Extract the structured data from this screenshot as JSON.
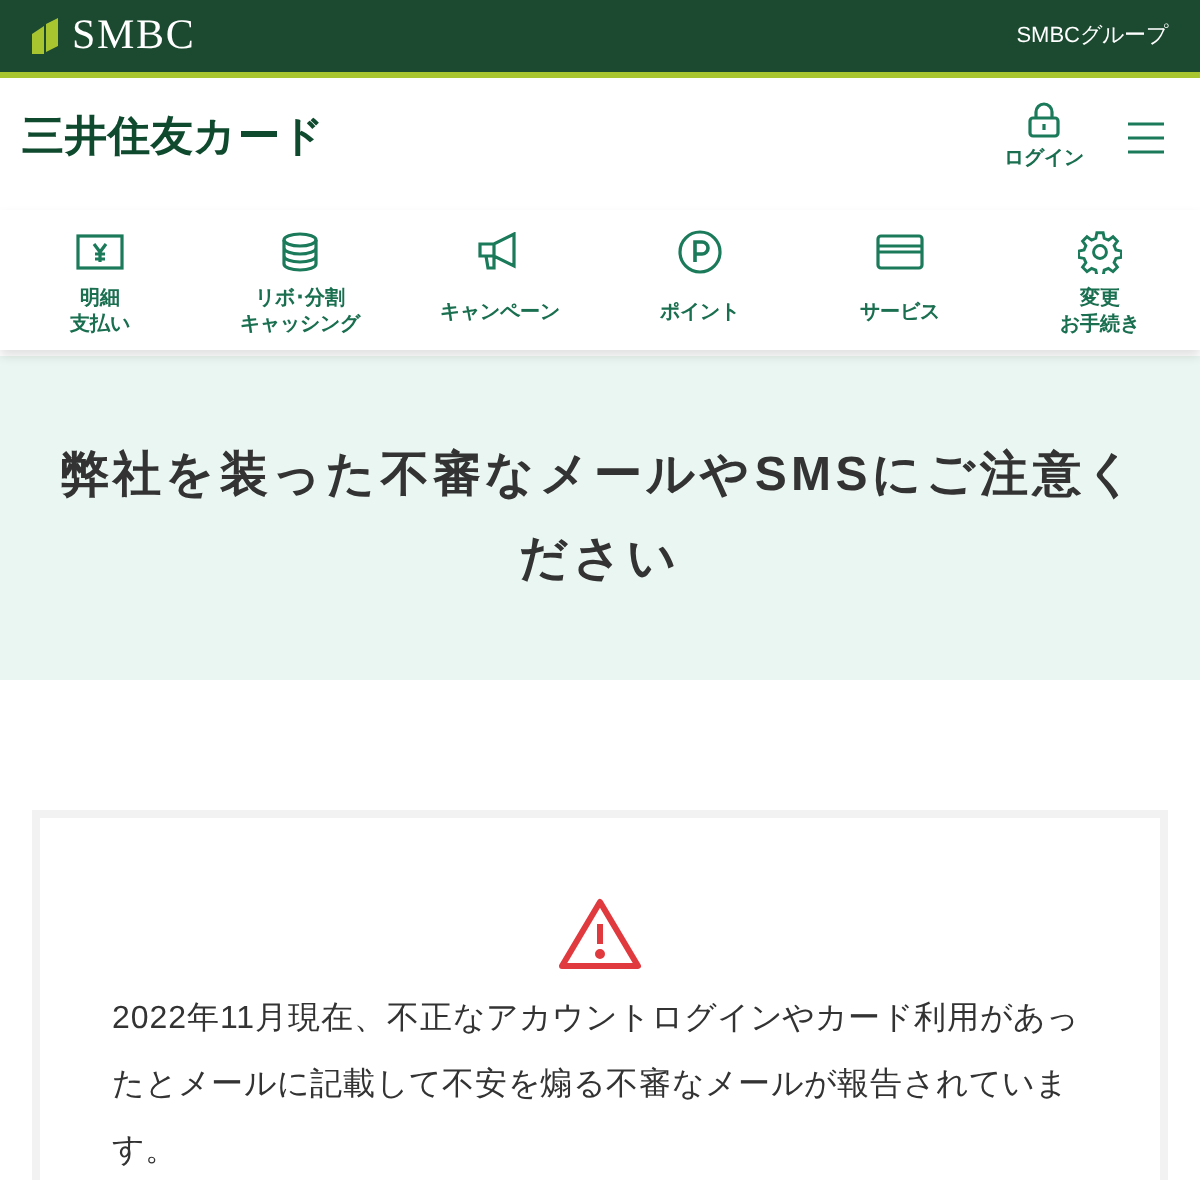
{
  "top_bar": {
    "brand": "SMBC",
    "group_link": "SMBCグループ"
  },
  "header": {
    "logo": "三井住友カード",
    "login": "ログイン"
  },
  "nav": [
    {
      "kind": "yen",
      "label_lines": [
        "明細",
        "支払い"
      ]
    },
    {
      "kind": "coins",
      "label_lines": [
        "リボ･分割",
        "キャッシング"
      ]
    },
    {
      "kind": "megaphone",
      "label_lines": [
        "キャンペーン"
      ]
    },
    {
      "kind": "point",
      "label_lines": [
        "ポイント"
      ]
    },
    {
      "kind": "card",
      "label_lines": [
        "サービス"
      ]
    },
    {
      "kind": "gear",
      "label_lines": [
        "変更",
        "お手続き"
      ]
    }
  ],
  "hero": {
    "title": "弊社を装った不審なメールやSMSにご注意ください"
  },
  "notice": {
    "text": "2022年11月現在、不正なアカウントログインやカード利用があったとメールに記載して不安を煽る不審なメールが報告されています。"
  }
}
